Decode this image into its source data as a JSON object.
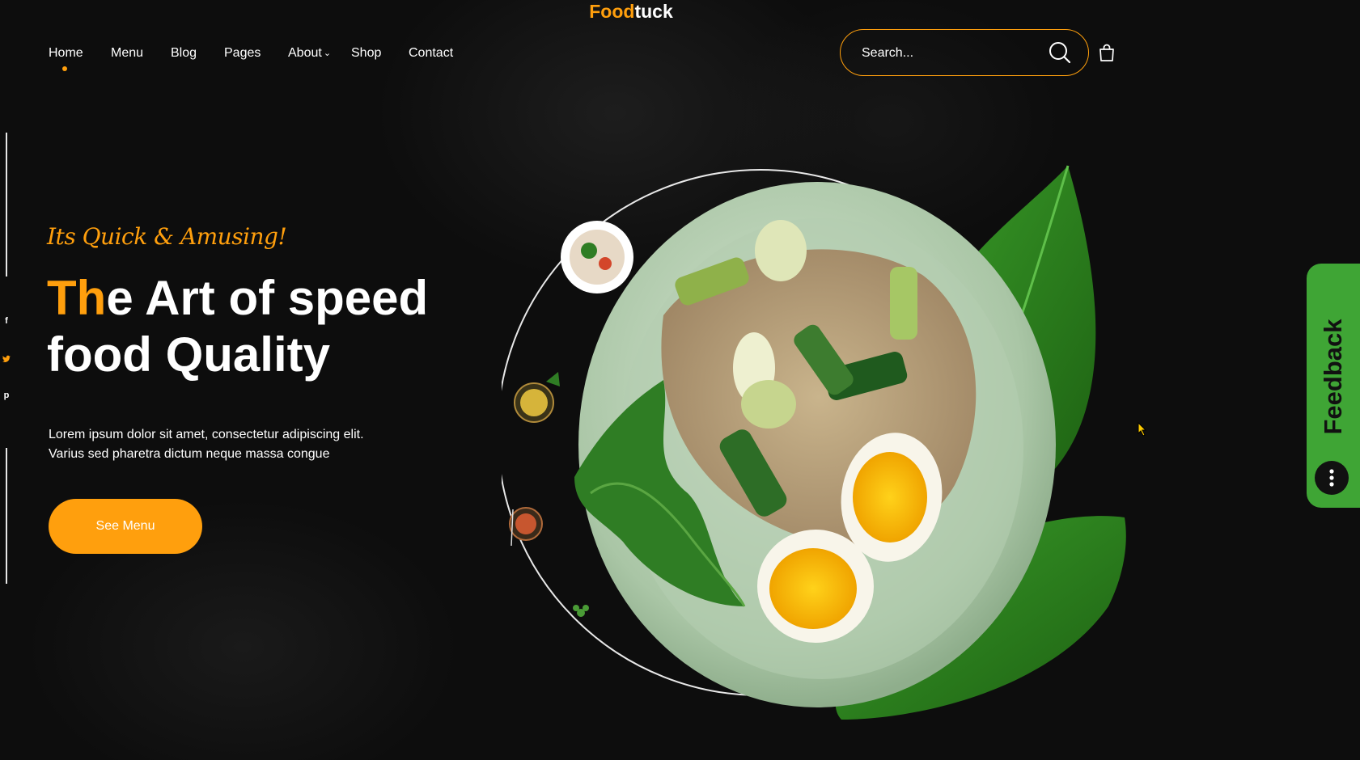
{
  "brand": {
    "part1": "Food",
    "part2": "tuck"
  },
  "nav": {
    "items": [
      {
        "label": "Home",
        "active": true
      },
      {
        "label": "Menu"
      },
      {
        "label": "Blog"
      },
      {
        "label": "Pages"
      },
      {
        "label": "About",
        "dropdown": true
      },
      {
        "label": "Shop"
      },
      {
        "label": "Contact"
      }
    ]
  },
  "search": {
    "placeholder": "Search..."
  },
  "social": {
    "facebook": "f",
    "twitter": "twitter-icon",
    "pinterest": "p"
  },
  "hero": {
    "tagline": "Its Quick & Amusing!",
    "headline_highlight": "Th",
    "headline_line1": "e Art of speed",
    "headline_line2": "food Quality",
    "desc_line1": "Lorem ipsum dolor sit amet, consectetur adipiscing elit.",
    "desc_line2": "Varius sed pharetra dictum neque massa congue",
    "cta_label": "See Menu"
  },
  "feedback": {
    "label": "Feedback"
  },
  "colors": {
    "accent": "#ff9f0d",
    "background": "#0d0d0d",
    "feedback_green": "#3fa535",
    "plate": "#b9d2b8",
    "leaf": "#2f8f1f"
  }
}
